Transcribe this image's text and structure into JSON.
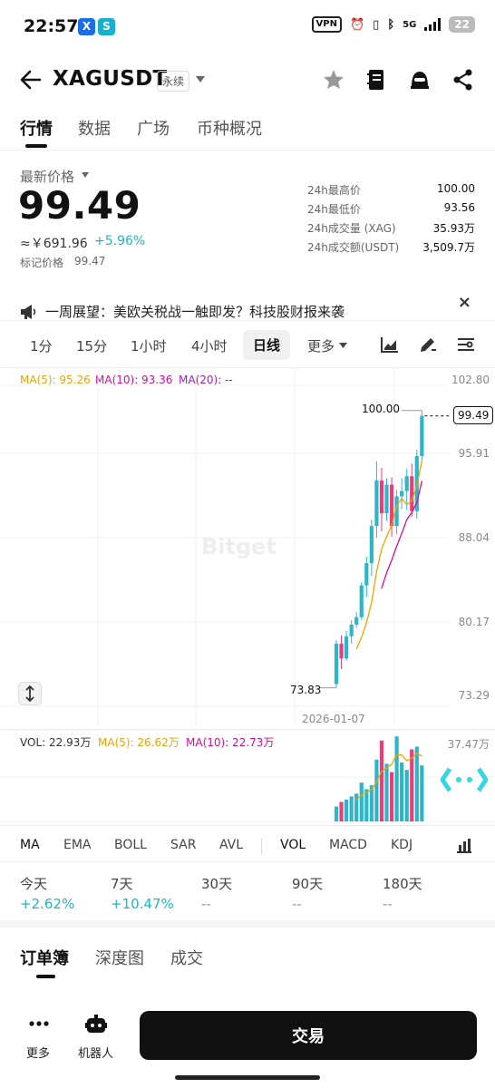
{
  "status_bar": {
    "time": "22:57",
    "app_badges": [
      "X",
      "S"
    ],
    "vpn_label": "VPN",
    "network_label": "5G",
    "battery": "22"
  },
  "header": {
    "symbol": "XAGUSDT",
    "contract_type": "永续",
    "icons": [
      "back-arrow-icon",
      "chevron-down-icon",
      "star-icon",
      "notebook-icon",
      "bot-face-icon",
      "share-icon"
    ]
  },
  "tabs": [
    "行情",
    "数据",
    "广场",
    "币种概况"
  ],
  "price": {
    "label": "最新价格",
    "last": "99.49",
    "cny": "≈￥691.96",
    "change": "+5.96%",
    "mark_label": "标记价格",
    "mark": "99.47"
  },
  "stats": [
    {
      "key": "24h最高价",
      "value": "100.00"
    },
    {
      "key": "24h最低价",
      "value": "93.56"
    },
    {
      "key": "24h成交量 (XAG)",
      "value": "35.93万"
    },
    {
      "key": "24h成交额(USDT)",
      "value": "3,509.7万"
    }
  ],
  "notice": {
    "text": "一周展望：美欧关税战一触即发？科技股财报来袭",
    "close": "×"
  },
  "intervals": [
    "1分",
    "15分",
    "1小时",
    "4小时",
    "日线",
    "更多"
  ],
  "active_interval": "日线",
  "ma": {
    "ma5": "MA(5): 95.26",
    "ma10": "MA(10): 93.36",
    "ma20": "MA(20): --",
    "colors": {
      "ma5": "#e8a400",
      "ma10": "#d0109a",
      "ma20": "#a020c0"
    }
  },
  "chart_axis": {
    "ticks": [
      "102.80",
      "95.91",
      "88.04",
      "80.17",
      "73.29"
    ],
    "current_price_tag": "99.49",
    "high_marker": "100.00",
    "low_marker": "73.83",
    "date_label": "2026-01-07",
    "watermark": "Bitget"
  },
  "volume": {
    "vol": "VOL: 22.93万",
    "ma5": "MA(5): 26.62万",
    "ma10": "MA(10): 22.73万",
    "axis_max": "37.47万"
  },
  "colors": {
    "up": "#2ab7c8",
    "down": "#ea3d7a",
    "accent": "#1fb6c4"
  },
  "indicators": [
    "MA",
    "EMA",
    "BOLL",
    "SAR",
    "AVL",
    "VOL",
    "MACD",
    "KDJ"
  ],
  "performance": [
    {
      "label": "今天",
      "value": "+2.62%"
    },
    {
      "label": "7天",
      "value": "+10.47%"
    },
    {
      "label": "30天",
      "value": "--"
    },
    {
      "label": "90天",
      "value": "--"
    },
    {
      "label": "180天",
      "value": "--"
    }
  ],
  "book_tabs": [
    "订单簿",
    "深度图",
    "成交"
  ],
  "bottom_bar": {
    "more": "更多",
    "bot": "机器人",
    "trade": "交易"
  },
  "chart_data": {
    "type": "candlestick",
    "interval": "日线",
    "ylim": [
      73.29,
      102.8
    ],
    "candles": [
      {
        "o": 74.2,
        "h": 78.3,
        "l": 73.83,
        "c": 78.0
      },
      {
        "o": 78.0,
        "h": 78.8,
        "l": 75.6,
        "c": 76.6
      },
      {
        "o": 76.6,
        "h": 79.2,
        "l": 76.4,
        "c": 78.7
      },
      {
        "o": 78.7,
        "h": 80.2,
        "l": 78.0,
        "c": 79.8
      },
      {
        "o": 79.8,
        "h": 81.0,
        "l": 79.5,
        "c": 80.5
      },
      {
        "o": 80.5,
        "h": 83.8,
        "l": 80.2,
        "c": 83.5
      },
      {
        "o": 83.5,
        "h": 86.2,
        "l": 82.4,
        "c": 85.6
      },
      {
        "o": 85.6,
        "h": 89.7,
        "l": 84.4,
        "c": 89.1
      },
      {
        "o": 89.1,
        "h": 95.2,
        "l": 88.0,
        "c": 93.4
      },
      {
        "o": 93.4,
        "h": 94.6,
        "l": 88.6,
        "c": 90.3
      },
      {
        "o": 90.3,
        "h": 93.6,
        "l": 89.6,
        "c": 93.0
      },
      {
        "o": 93.0,
        "h": 93.7,
        "l": 88.1,
        "c": 89.1
      },
      {
        "o": 89.1,
        "h": 92.5,
        "l": 88.3,
        "c": 91.9
      },
      {
        "o": 91.9,
        "h": 93.6,
        "l": 90.7,
        "c": 92.4
      },
      {
        "o": 92.4,
        "h": 94.5,
        "l": 90.6,
        "c": 93.8
      },
      {
        "o": 93.8,
        "h": 95.0,
        "l": 90.0,
        "c": 90.5
      },
      {
        "o": 90.5,
        "h": 96.3,
        "l": 89.8,
        "c": 95.7
      },
      {
        "o": 95.7,
        "h": 100.0,
        "l": 95.2,
        "c": 99.49
      }
    ],
    "ma5": [
      null,
      null,
      null,
      null,
      77.5,
      78.6,
      80.0,
      81.9,
      84.8,
      86.9,
      88.1,
      89.2,
      91.0,
      91.7,
      91.1,
      91.5,
      92.9,
      95.26
    ],
    "ma10": [
      null,
      null,
      null,
      null,
      null,
      null,
      null,
      null,
      null,
      83.2,
      84.7,
      85.9,
      87.2,
      88.4,
      89.7,
      90.4,
      91.3,
      93.36
    ],
    "volume": [
      6.1,
      8.0,
      8.9,
      10.2,
      11.4,
      15.9,
      13.2,
      14.8,
      25.3,
      33.1,
      23.6,
      20.2,
      34.8,
      24.1,
      21.1,
      29.5,
      30.6,
      22.93
    ],
    "volume_ma5": [
      null,
      null,
      null,
      null,
      8.9,
      10.9,
      11.9,
      13.1,
      16.1,
      20.5,
      22.0,
      23.4,
      27.4,
      27.2,
      24.8,
      25.9,
      28.0,
      26.62
    ]
  }
}
